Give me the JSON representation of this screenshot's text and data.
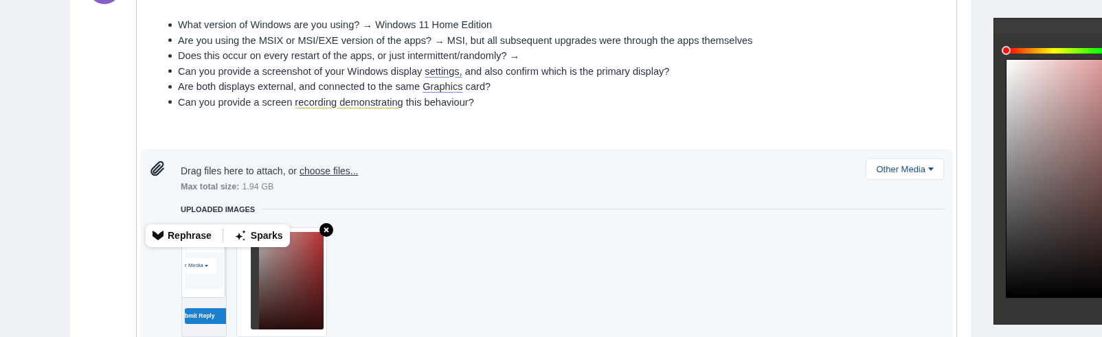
{
  "post": {
    "bullets": [
      [
        {
          "text": "What version of Windows are you using? → Windows 11 Home Edition",
          "kind": "plain"
        }
      ],
      [
        {
          "text": "Are you using the MSIX or MSI/EXE version of the apps? → MSI, but all subsequent upgrades were through the apps themselves",
          "kind": "plain"
        }
      ],
      [
        {
          "text": "Does this occur on every restart of the apps, or just intermittent/randomly? →",
          "kind": "plain"
        }
      ],
      [
        {
          "text": "Can you provide a screenshot of your Windows display ",
          "kind": "plain"
        },
        {
          "text": "settings,",
          "kind": "spelling"
        },
        {
          "text": " and also confirm which is the primary display?",
          "kind": "plain"
        }
      ],
      [
        {
          "text": "Are both displays external, and connected to the same ",
          "kind": "plain"
        },
        {
          "text": "Graphics",
          "kind": "spelling"
        },
        {
          "text": " card?",
          "kind": "plain"
        }
      ],
      [
        {
          "text": "Can you provide a screen ",
          "kind": "plain"
        },
        {
          "text": "recording demonstrating",
          "kind": "grammar"
        },
        {
          "text": " this behaviour?",
          "kind": "plain"
        }
      ]
    ]
  },
  "attachments": {
    "drop_text": "Drag files here to attach, or",
    "choose_link": "choose files...",
    "max_label": "Max total size:",
    "max_value": "1.94 GB",
    "other_media": "Other Media",
    "uploaded_heading": "UPLOADED IMAGES",
    "images": [
      {
        "kind": "screenshot",
        "media_text": "r Media",
        "submit_text": "bmit Reply"
      },
      {
        "kind": "picker"
      }
    ]
  },
  "toolbar": {
    "items": [
      {
        "kind": "rephrase",
        "label": "Rephrase"
      },
      {
        "kind": "sparks",
        "label": "Sparks"
      }
    ]
  }
}
